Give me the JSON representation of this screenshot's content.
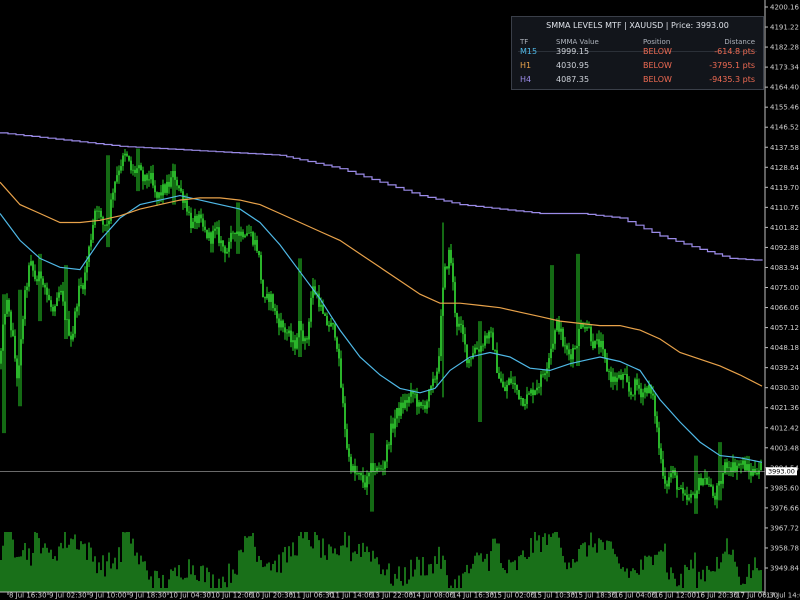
{
  "panel": {
    "title": "SMMA LEVELS MTF  |  XAUUSD  |  Price: 3993.00",
    "headers": {
      "tf": "TF",
      "value": "SMMA Value",
      "position": "Position",
      "distance": "Distance"
    },
    "rows": [
      {
        "tf": "M15",
        "value": "3999.15",
        "position": "BELOW",
        "distance": "-614.8 pts",
        "tf_color": "#4fb8e6"
      },
      {
        "tf": "H1",
        "value": "4030.95",
        "position": "BELOW",
        "distance": "-3795.1 pts",
        "tf_color": "#e8a24a"
      },
      {
        "tf": "H4",
        "value": "4087.35",
        "position": "BELOW",
        "distance": "-9435.3 pts",
        "tf_color": "#9b8be8"
      }
    ],
    "position_color": "#f06b53",
    "distance_color": "#f06b53"
  },
  "chart_data": {
    "type": "candlestick",
    "symbol": "XAUUSD",
    "current_price": 3993.0,
    "current_price_label": "3993.00",
    "ylim": [
      3944.0,
      4202.0
    ],
    "y_ticks": [
      "4200.16",
      "4191.22",
      "4182.28",
      "4173.34",
      "4164.40",
      "4155.46",
      "4146.52",
      "4137.58",
      "4128.64",
      "4119.70",
      "4110.76",
      "4101.82",
      "4092.88",
      "4083.94",
      "4075.00",
      "4066.06",
      "4057.12",
      "4048.18",
      "4039.24",
      "4030.30",
      "4021.36",
      "4012.42",
      "4003.48",
      "3994.54",
      "3985.60",
      "3976.66",
      "3967.72",
      "3958.78",
      "3949.84"
    ],
    "x_ticks": [
      "8 Jul 16:30",
      "9 Jul 02:30",
      "9 Jul 10:00",
      "9 Jul 18:30",
      "10 Jul 04:30",
      "10 Jul 12:00",
      "10 Jul 20:30",
      "11 Jul 06:30",
      "11 Jul 14:00",
      "13 Jul 22:00",
      "14 Jul 08:00",
      "14 Jul 16:30",
      "15 Jul 02:00",
      "15 Jul 10:30",
      "15 Jul 18:30",
      "16 Jul 04:00",
      "16 Jul 12:00",
      "16 Jul 20:30",
      "17 Jul 06:30",
      "17 Jul 14:00"
    ],
    "close_path": [
      [
        0,
        4041
      ],
      [
        6,
        4070
      ],
      [
        12,
        4055
      ],
      [
        18,
        4032
      ],
      [
        24,
        4068
      ],
      [
        30,
        4086
      ],
      [
        36,
        4078
      ],
      [
        42,
        4081
      ],
      [
        48,
        4070
      ],
      [
        54,
        4062
      ],
      [
        60,
        4074
      ],
      [
        66,
        4060
      ],
      [
        72,
        4052
      ],
      [
        78,
        4073
      ],
      [
        84,
        4078
      ],
      [
        90,
        4095
      ],
      [
        96,
        4113
      ],
      [
        102,
        4103
      ],
      [
        108,
        4104
      ],
      [
        114,
        4122
      ],
      [
        120,
        4130
      ],
      [
        126,
        4134
      ],
      [
        132,
        4126
      ],
      [
        138,
        4128
      ],
      [
        144,
        4122
      ],
      [
        150,
        4125
      ],
      [
        156,
        4114
      ],
      [
        162,
        4118
      ],
      [
        168,
        4120
      ],
      [
        174,
        4126
      ],
      [
        180,
        4118
      ],
      [
        186,
        4113
      ],
      [
        192,
        4102
      ],
      [
        198,
        4106
      ],
      [
        204,
        4100
      ],
      [
        210,
        4097
      ],
      [
        216,
        4100
      ],
      [
        222,
        4094
      ],
      [
        228,
        4091
      ],
      [
        234,
        4102
      ],
      [
        240,
        4099
      ],
      [
        246,
        4101
      ],
      [
        252,
        4098
      ],
      [
        258,
        4092
      ],
      [
        264,
        4067
      ],
      [
        270,
        4072
      ],
      [
        276,
        4062
      ],
      [
        282,
        4058
      ],
      [
        288,
        4054
      ],
      [
        294,
        4048
      ],
      [
        300,
        4060
      ],
      [
        306,
        4048
      ],
      [
        312,
        4075
      ],
      [
        318,
        4071
      ],
      [
        324,
        4060
      ],
      [
        330,
        4058
      ],
      [
        336,
        4055
      ],
      [
        342,
        4026
      ],
      [
        348,
        4000
      ],
      [
        354,
        3992
      ],
      [
        360,
        3990
      ],
      [
        366,
        3987
      ],
      [
        372,
        3995
      ],
      [
        378,
        3993
      ],
      [
        384,
        3996
      ],
      [
        390,
        4010
      ],
      [
        396,
        4018
      ],
      [
        402,
        4022
      ],
      [
        408,
        4025
      ],
      [
        414,
        4028
      ],
      [
        420,
        4020
      ],
      [
        426,
        4024
      ],
      [
        432,
        4030
      ],
      [
        438,
        4040
      ],
      [
        444,
        4080
      ],
      [
        450,
        4092
      ],
      [
        456,
        4060
      ],
      [
        462,
        4055
      ],
      [
        468,
        4042
      ],
      [
        474,
        4048
      ],
      [
        480,
        4048
      ],
      [
        486,
        4054
      ],
      [
        492,
        4052
      ],
      [
        498,
        4037
      ],
      [
        504,
        4028
      ],
      [
        510,
        4034
      ],
      [
        516,
        4030
      ],
      [
        522,
        4025
      ],
      [
        528,
        4026
      ],
      [
        534,
        4030
      ],
      [
        540,
        4033
      ],
      [
        546,
        4040
      ],
      [
        552,
        4050
      ],
      [
        558,
        4060
      ],
      [
        564,
        4048
      ],
      [
        570,
        4045
      ],
      [
        576,
        4050
      ],
      [
        582,
        4060
      ],
      [
        588,
        4058
      ],
      [
        594,
        4049
      ],
      [
        600,
        4050
      ],
      [
        606,
        4040
      ],
      [
        612,
        4034
      ],
      [
        618,
        4034
      ],
      [
        624,
        4035
      ],
      [
        630,
        4027
      ],
      [
        636,
        4032
      ],
      [
        642,
        4028
      ],
      [
        648,
        4031
      ],
      [
        654,
        4023
      ],
      [
        660,
        4000
      ],
      [
        666,
        3987
      ],
      [
        672,
        3993
      ],
      [
        678,
        3986
      ],
      [
        684,
        3980
      ],
      [
        690,
        3980
      ],
      [
        696,
        3984
      ],
      [
        702,
        3991
      ],
      [
        708,
        3988
      ],
      [
        714,
        3981
      ],
      [
        720,
        3987
      ],
      [
        726,
        3997
      ],
      [
        732,
        3995
      ],
      [
        738,
        3996
      ],
      [
        744,
        3996
      ],
      [
        750,
        3992
      ],
      [
        756,
        3994
      ],
      [
        762,
        3995
      ]
    ],
    "spikes": [
      [
        4,
        4010,
        4072
      ],
      [
        20,
        4022,
        4074
      ],
      [
        40,
        4060,
        4090
      ],
      [
        66,
        4052,
        4085
      ],
      [
        108,
        4093,
        4134
      ],
      [
        138,
        4118,
        4137
      ],
      [
        174,
        4112,
        4130
      ],
      [
        238,
        4090,
        4113
      ],
      [
        300,
        4044,
        4088
      ],
      [
        372,
        3975,
        4010
      ],
      [
        443,
        4026,
        4104
      ],
      [
        480,
        4015,
        4060
      ],
      [
        552,
        4048,
        4085
      ],
      [
        578,
        4040,
        4090
      ],
      [
        696,
        3974,
        4000
      ],
      [
        720,
        3980,
        4006
      ]
    ],
    "series": [
      {
        "name": "M15",
        "color": "#4fb8e6",
        "points": [
          [
            0,
            4108
          ],
          [
            20,
            4096
          ],
          [
            40,
            4088
          ],
          [
            60,
            4084
          ],
          [
            80,
            4083
          ],
          [
            100,
            4096
          ],
          [
            120,
            4106
          ],
          [
            140,
            4112
          ],
          [
            160,
            4114
          ],
          [
            180,
            4116
          ],
          [
            200,
            4114
          ],
          [
            220,
            4112
          ],
          [
            240,
            4110
          ],
          [
            260,
            4104
          ],
          [
            280,
            4094
          ],
          [
            300,
            4082
          ],
          [
            320,
            4070
          ],
          [
            340,
            4056
          ],
          [
            360,
            4044
          ],
          [
            380,
            4036
          ],
          [
            400,
            4030
          ],
          [
            420,
            4028
          ],
          [
            435,
            4030
          ],
          [
            450,
            4038
          ],
          [
            470,
            4044
          ],
          [
            490,
            4046
          ],
          [
            510,
            4044
          ],
          [
            530,
            4039
          ],
          [
            550,
            4038
          ],
          [
            570,
            4041
          ],
          [
            590,
            4043
          ],
          [
            600,
            4044
          ],
          [
            620,
            4042
          ],
          [
            640,
            4038
          ],
          [
            660,
            4025
          ],
          [
            680,
            4015
          ],
          [
            700,
            4006
          ],
          [
            720,
            4000
          ],
          [
            740,
            3999
          ],
          [
            762,
            3997
          ]
        ]
      },
      {
        "name": "H1",
        "color": "#e8a24a",
        "points": [
          [
            0,
            4122
          ],
          [
            20,
            4112
          ],
          [
            40,
            4108
          ],
          [
            60,
            4104
          ],
          [
            80,
            4104
          ],
          [
            100,
            4105
          ],
          [
            120,
            4107
          ],
          [
            140,
            4110
          ],
          [
            160,
            4112
          ],
          [
            180,
            4114
          ],
          [
            200,
            4115
          ],
          [
            220,
            4115
          ],
          [
            240,
            4114
          ],
          [
            260,
            4112
          ],
          [
            280,
            4108
          ],
          [
            300,
            4104
          ],
          [
            320,
            4100
          ],
          [
            340,
            4096
          ],
          [
            360,
            4090
          ],
          [
            380,
            4084
          ],
          [
            400,
            4078
          ],
          [
            420,
            4072
          ],
          [
            440,
            4068
          ],
          [
            460,
            4068
          ],
          [
            480,
            4067
          ],
          [
            500,
            4066
          ],
          [
            520,
            4064
          ],
          [
            540,
            4062
          ],
          [
            560,
            4060
          ],
          [
            580,
            4059
          ],
          [
            600,
            4058
          ],
          [
            620,
            4058
          ],
          [
            640,
            4056
          ],
          [
            660,
            4052
          ],
          [
            680,
            4046
          ],
          [
            700,
            4043
          ],
          [
            720,
            4040
          ],
          [
            740,
            4036
          ],
          [
            762,
            4031
          ]
        ]
      },
      {
        "name": "H4",
        "color": "#9b8be8",
        "points": [
          [
            0,
            4144
          ],
          [
            40,
            4142
          ],
          [
            80,
            4140
          ],
          [
            120,
            4138
          ],
          [
            160,
            4137
          ],
          [
            200,
            4136
          ],
          [
            240,
            4135
          ],
          [
            280,
            4134
          ],
          [
            300,
            4132
          ],
          [
            340,
            4128
          ],
          [
            380,
            4122
          ],
          [
            420,
            4116
          ],
          [
            460,
            4112
          ],
          [
            500,
            4110
          ],
          [
            540,
            4108
          ],
          [
            580,
            4108
          ],
          [
            620,
            4106
          ],
          [
            660,
            4098
          ],
          [
            700,
            4092
          ],
          [
            730,
            4088
          ],
          [
            762,
            4087
          ]
        ]
      }
    ]
  },
  "volume": {
    "bar_color": "#24a124"
  }
}
